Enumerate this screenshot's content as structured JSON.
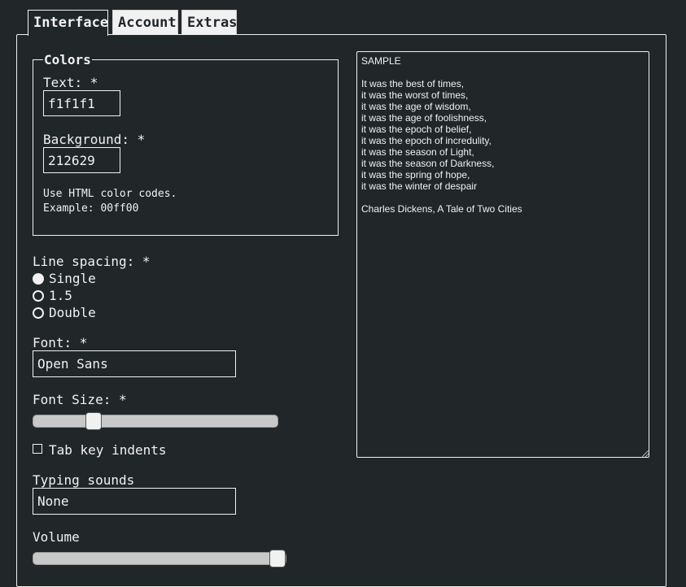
{
  "tabs": [
    {
      "label": "Interface",
      "active": true
    },
    {
      "label": "Account",
      "active": false
    },
    {
      "label": "Extras",
      "active": false
    }
  ],
  "colors": {
    "legend": "Colors",
    "text_label": "Text: *",
    "text_value": "f1f1f1",
    "background_label": "Background: *",
    "background_value": "212629",
    "hint": "Use HTML color codes.\nExample: 00ff00"
  },
  "line_spacing": {
    "label": "Line spacing: *",
    "options": [
      {
        "label": "Single",
        "checked": true
      },
      {
        "label": "1.5",
        "checked": false
      },
      {
        "label": "Double",
        "checked": false
      }
    ]
  },
  "font": {
    "label": "Font: *",
    "value": "Open Sans"
  },
  "font_size": {
    "label": "Font Size: *",
    "value_fraction": 0.23
  },
  "tab_indent": {
    "label": "Tab key indents",
    "checked": false
  },
  "typing_sounds": {
    "label": "Typing sounds",
    "value": "None"
  },
  "volume": {
    "label": "Volume",
    "value_fraction": 1.0
  },
  "sample": {
    "text": "SAMPLE\n\nIt was the best of times,\nit was the worst of times,\nit was the age of wisdom,\nit was the age of foolishness,\nit was the epoch of belief,\nit was the epoch of incredulity,\nit was the season of Light,\nit was the season of Darkness,\nit was the spring of hope,\nit was the winter of despair\n\nCharles Dickens, A Tale of Two Cities"
  },
  "theme": {
    "foreground": "#f1f1f1",
    "background": "#212629"
  }
}
